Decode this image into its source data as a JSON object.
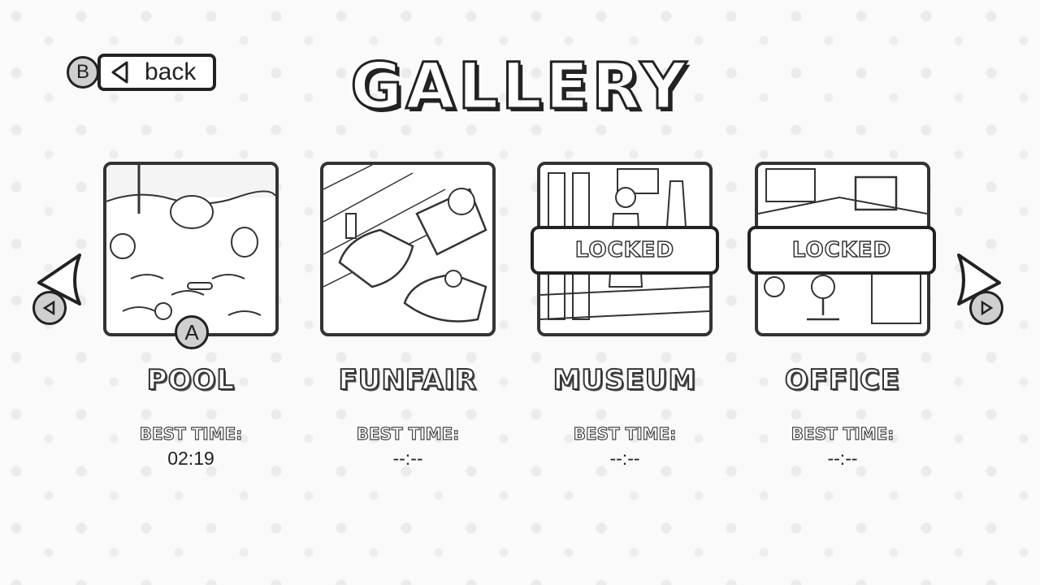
{
  "title": "GALLERY",
  "back": {
    "label": "back",
    "key": "B"
  },
  "select_key": "A",
  "levels": [
    {
      "name": "POOL",
      "best_label": "BEST TIME:",
      "best_time": "02:19",
      "locked": false
    },
    {
      "name": "FUNFAIR",
      "best_label": "BEST TIME:",
      "best_time": "--:--",
      "locked": false
    },
    {
      "name": "MUSEUM",
      "best_label": "BEST TIME:",
      "best_time": "--:--",
      "locked": true,
      "lock_label": "LOCKED"
    },
    {
      "name": "OFFICE",
      "best_label": "BEST TIME:",
      "best_time": "--:--",
      "locked": true,
      "lock_label": "LOCKED"
    }
  ],
  "icons": {
    "prev": "left-arrow-icon",
    "next": "right-arrow-icon",
    "prev_key": "left-trigger-icon",
    "next_key": "right-trigger-icon"
  }
}
